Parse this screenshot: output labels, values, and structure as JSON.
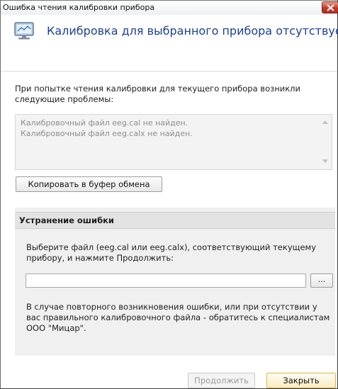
{
  "window": {
    "title": "Ошибка чтения калибровки прибора",
    "close_icon": "close-icon"
  },
  "header": {
    "icon": "monitor-warning-icon",
    "title": "Калибровка для выбранного прибора отсутствует"
  },
  "problems": {
    "intro": "При попытке чтения калибровки для текущего прибора возникли следующие проблемы:",
    "log": [
      "Калибровочный файл eeg.cal не найден.",
      "Калибровочный файл eeg.calx не найден."
    ],
    "copy_label": "Копировать в буфер обмена"
  },
  "fix": {
    "title": "Устранение ошибки",
    "instruction": "Выберите файл (eeg.cal или eeg.calx), соответствующий текущему прибору, и нажмите Продолжить:",
    "file_value": "",
    "browse_label": "...",
    "help": "В случае повторного возникновения ошибки, или при отсутствии у вас правильного калибровочного файла - обратитесь к специалистам ООО \"Мицар\"."
  },
  "actions": {
    "continue_label": "Продолжить",
    "close_label": "Закрыть"
  },
  "colors": {
    "accent_title": "#1c3f96",
    "close_button_border": "#e0b24b"
  }
}
